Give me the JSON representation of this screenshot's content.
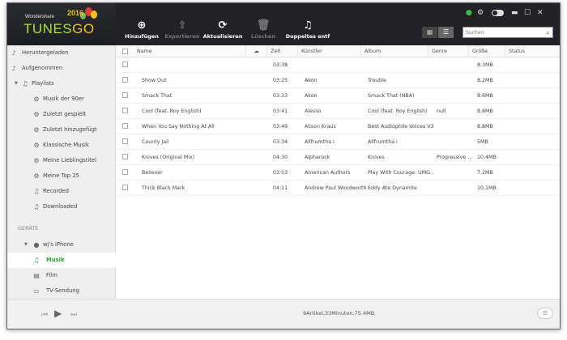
{
  "app": {
    "brand_top": "Wondershare",
    "brand_main_a": "TUNES",
    "brand_main_b": "GO",
    "year": "2016"
  },
  "toolbar": {
    "add_label": "Hinzufügen",
    "export_label": "Exportieren",
    "refresh_label": "Aktualisieren",
    "delete_label": "Löschen",
    "duplicates_label": "Doppeltes entf"
  },
  "search": {
    "placeholder": "Suchen"
  },
  "sidebar": {
    "items": [
      {
        "label": "Heruntergeladen"
      },
      {
        "label": "Aufgenommen"
      },
      {
        "label": "Playlists"
      },
      {
        "label": "Musik der 90er"
      },
      {
        "label": "Zuletzt gespielt"
      },
      {
        "label": "Zuletzt hinzugefügt"
      },
      {
        "label": "Klassische Musik"
      },
      {
        "label": "Meine Lieblingstitel"
      },
      {
        "label": "Meine Top 25"
      },
      {
        "label": "Recorded"
      },
      {
        "label": "Downloaded"
      }
    ],
    "section_label": "GERÄTE",
    "device": "wj's iPhone",
    "device_items": [
      {
        "label": "Musik"
      },
      {
        "label": "Film"
      },
      {
        "label": "TV-Sendung"
      }
    ]
  },
  "table": {
    "headers": {
      "name": "Name",
      "time": "Zeit",
      "artist": "Künstler",
      "album": "Album",
      "genre": "Genre",
      "size": "Größe",
      "status": "Status"
    },
    "rows": [
      {
        "name": "",
        "time": "03:38",
        "artist": "",
        "album": "",
        "genre": "",
        "size": "8.3MB"
      },
      {
        "name": "Show Out",
        "time": "03:25",
        "artist": "Akon",
        "album": "Trouble",
        "genre": "",
        "size": "8.2MB"
      },
      {
        "name": "Smack That",
        "time": "03:33",
        "artist": "Akon",
        "album": "Smack That (NBA)",
        "genre": "",
        "size": "8.6MB"
      },
      {
        "name": "Cool (feat. Roy English)",
        "time": "03:41",
        "artist": "Alesso",
        "album": "Cool (feat. Roy English)",
        "genre": "null",
        "size": "8.8MB"
      },
      {
        "name": "When You Say Nothing At All",
        "time": "03:49",
        "artist": "Alison Kraus",
        "album": "Best Audiophile Voices V3",
        "genre": "",
        "size": "8.8MB"
      },
      {
        "name": "County Jail",
        "time": "03:34",
        "artist": "Allfrumtha i",
        "album": "Allfrumtha i",
        "genre": "",
        "size": "5MB"
      },
      {
        "name": "Knives (Original Mix)",
        "time": "04:30",
        "artist": "Alpharock",
        "album": "Knives",
        "genre": "Progressive ...",
        "size": "10.4MB"
      },
      {
        "name": "Believer",
        "time": "03:03",
        "artist": "American Authors",
        "album": "Play With Courage: UMG...",
        "genre": "",
        "size": "7.2MB"
      },
      {
        "name": "Thick Black Mark",
        "time": "04:11",
        "artist": "Andrew Paul Woodworth",
        "album": "Eddy Ate Dynamite",
        "genre": "",
        "size": "10.1MB"
      }
    ]
  },
  "statusbar": {
    "summary": "9Artikel,33Minuten,75.4MB"
  },
  "colors": {
    "accent": "#2aa236",
    "topbar": "#222226"
  }
}
